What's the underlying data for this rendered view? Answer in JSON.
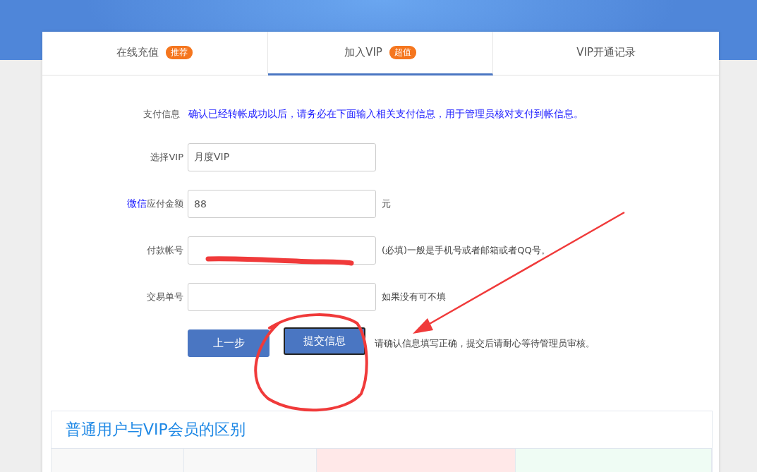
{
  "tabs": [
    {
      "label": "在线充值",
      "badge": "推荐",
      "selected": false
    },
    {
      "label": "加入VIP",
      "badge": "超值",
      "selected": true
    },
    {
      "label": "VIP开通记录",
      "selected": false
    }
  ],
  "form": {
    "notice": {
      "label": "支付信息",
      "text": "确认已经转帐成功以后，请务必在下面输入相关支付信息，用于管理员核对支付到帐信息。"
    },
    "fields": [
      {
        "label": "选择VIP",
        "value": "月度VIP"
      },
      {
        "label": "应付金额",
        "prefix": "微信",
        "value": "88",
        "suffix": "元"
      },
      {
        "label": "付款帐号",
        "suffix": "(必填)一般是手机号或者邮箱或者QQ号。"
      },
      {
        "label": "交易单号",
        "suffix": "如果没有可不填"
      }
    ],
    "buttons": [
      {
        "label": "上一步",
        "focused": false
      },
      {
        "label": "提交信息",
        "focused": true
      }
    ],
    "hint": "请确认信息填写正确，提交后请耐心等待管理员审核。"
  },
  "comparison": {
    "title": "普通用户与VIP会员的区别"
  }
}
